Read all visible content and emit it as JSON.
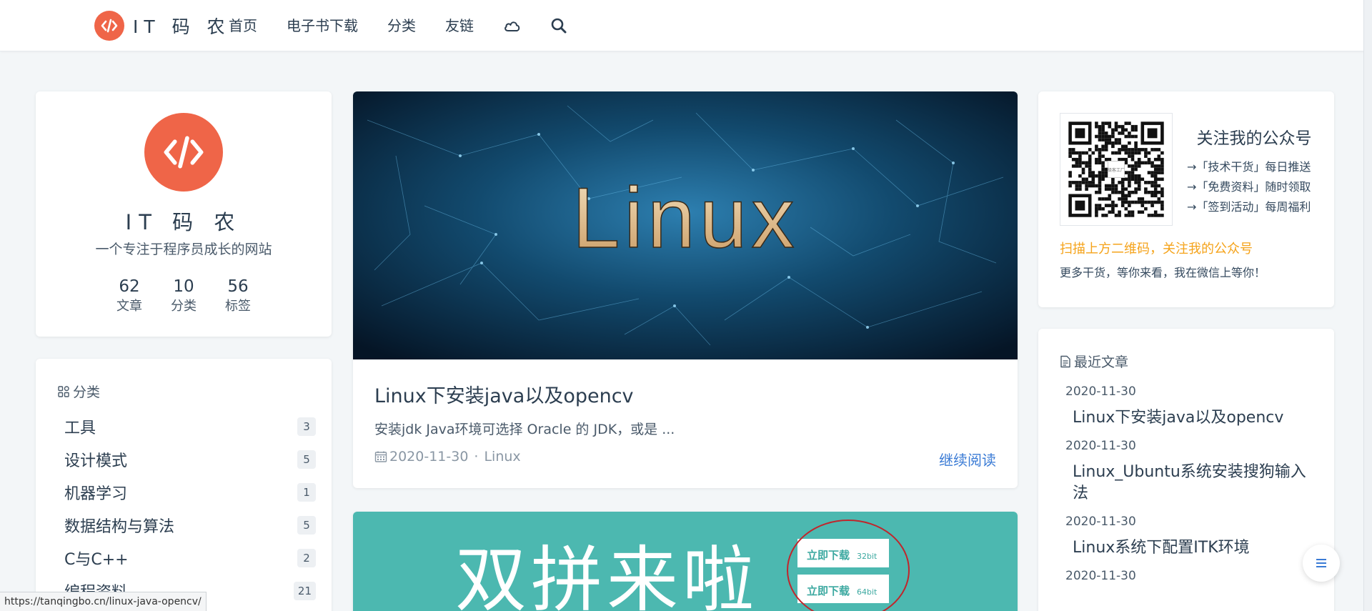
{
  "brand": {
    "name": "IT 码 农"
  },
  "nav": {
    "items": [
      "首页",
      "电子书下载",
      "分类",
      "友链"
    ],
    "icons": [
      "theme-cloud-icon",
      "search-icon"
    ]
  },
  "profile": {
    "name": "IT 码 农",
    "description": "一个专注于程序员成长的网站",
    "stats": [
      {
        "value": "62",
        "label": "文章"
      },
      {
        "value": "10",
        "label": "分类"
      },
      {
        "value": "56",
        "label": "标签"
      }
    ]
  },
  "categories": {
    "heading": "分类",
    "items": [
      {
        "name": "工具",
        "count": "3"
      },
      {
        "name": "设计模式",
        "count": "5"
      },
      {
        "name": "机器学习",
        "count": "1"
      },
      {
        "name": "数据结构与算法",
        "count": "5"
      },
      {
        "name": "C与C++",
        "count": "2"
      },
      {
        "name": "编程资料",
        "count": "21"
      },
      {
        "name": "",
        "count": ""
      }
    ]
  },
  "post": {
    "image_text": "Linux",
    "title": "Linux下安装java以及opencv",
    "excerpt": "安装jdk Java环境可选择 Oracle 的 JDK，或是 ...",
    "date": "2020-11-30",
    "category": "Linux",
    "read_more": "继续阅读"
  },
  "post2": {
    "banner_text": "双拼来啦",
    "button_32": "立即下载",
    "bit_32": "32bit",
    "button_64": "立即下载",
    "bit_64": "64bit"
  },
  "wechat": {
    "title": "关注我的公众号",
    "lines": [
      "→「技术干货」每日推送",
      "→「免费资料」随时领取",
      "→「签到活动」每周福利"
    ],
    "qr_caption": "极客工厂",
    "promo": "扫描上方二维码，关注我的公众号",
    "sub": "更多干货，等你来看，我在微信上等你！"
  },
  "recent": {
    "heading": "最近文章",
    "items": [
      {
        "date": "2020-11-30",
        "title": "Linux下安装java以及opencv"
      },
      {
        "date": "2020-11-30",
        "title": "Linux_Ubuntu系统安装搜狗输入法"
      },
      {
        "date": "2020-11-30",
        "title": "Linux系统下配置ITK环境"
      },
      {
        "date": "2020-11-30",
        "title": ""
      }
    ]
  },
  "status_bar": {
    "url": "https://tanqingbo.cn/linux-java-opencv/"
  },
  "colors": {
    "brand": "#ef6548",
    "link": "#3a7bd5",
    "promo": "#f5a31a",
    "banner": "#4cb8b0"
  }
}
